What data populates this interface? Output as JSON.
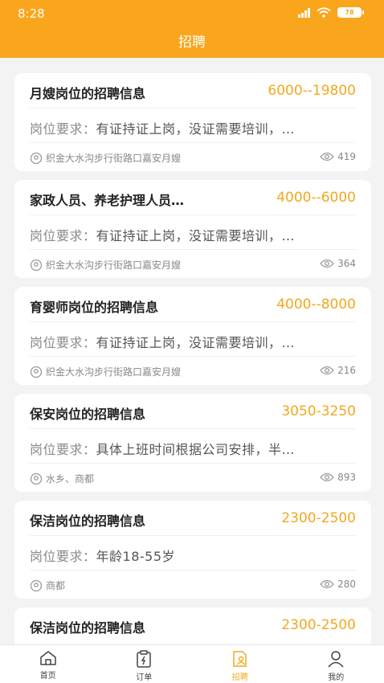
{
  "status_bar": {
    "time": "8:28",
    "battery": "78"
  },
  "header": {
    "title": "招聘"
  },
  "jobs": [
    {
      "title": "月嫂岗位的招聘信息",
      "salary": "6000--19800",
      "req_label": "岗位要求：",
      "req_text": "有证持证上岗，没证需要培训，…",
      "location": "织金大水沟步行街路口嘉安月嫂",
      "views": "419"
    },
    {
      "title": "家政人员、养老护理人员…",
      "salary": "4000--6000",
      "req_label": "岗位要求：",
      "req_text": "有证持证上岗，没证需要培训，…",
      "location": "织金大水沟步行街路口嘉安月嫂",
      "views": "364"
    },
    {
      "title": "育婴师岗位的招聘信息",
      "salary": "4000--8000",
      "req_label": "岗位要求：",
      "req_text": "有证持证上岗，没证需要培训，…",
      "location": "织金大水沟步行街路口嘉安月嫂",
      "views": "216"
    },
    {
      "title": "保安岗位的招聘信息",
      "salary": "3050-3250",
      "req_label": "岗位要求：",
      "req_text": "具体上班时间根据公司安排，半…",
      "location": "水乡、商都",
      "views": "893"
    },
    {
      "title": "保洁岗位的招聘信息",
      "salary": "2300-2500",
      "req_label": "岗位要求：",
      "req_text": "年龄18-55岁",
      "location": "商都",
      "views": "280"
    },
    {
      "title": "保洁岗位的招聘信息",
      "salary": "2300-2500",
      "req_label": "",
      "req_text": "",
      "location": "",
      "views": ""
    }
  ],
  "tabbar": [
    {
      "label": "首页",
      "icon": "home-icon"
    },
    {
      "label": "订单",
      "icon": "order-icon"
    },
    {
      "label": "招聘",
      "icon": "recruit-icon",
      "active": true
    },
    {
      "label": "我的",
      "icon": "profile-icon"
    }
  ],
  "colors": {
    "brand": "#f9a61c",
    "salary": "#f2a81d"
  }
}
